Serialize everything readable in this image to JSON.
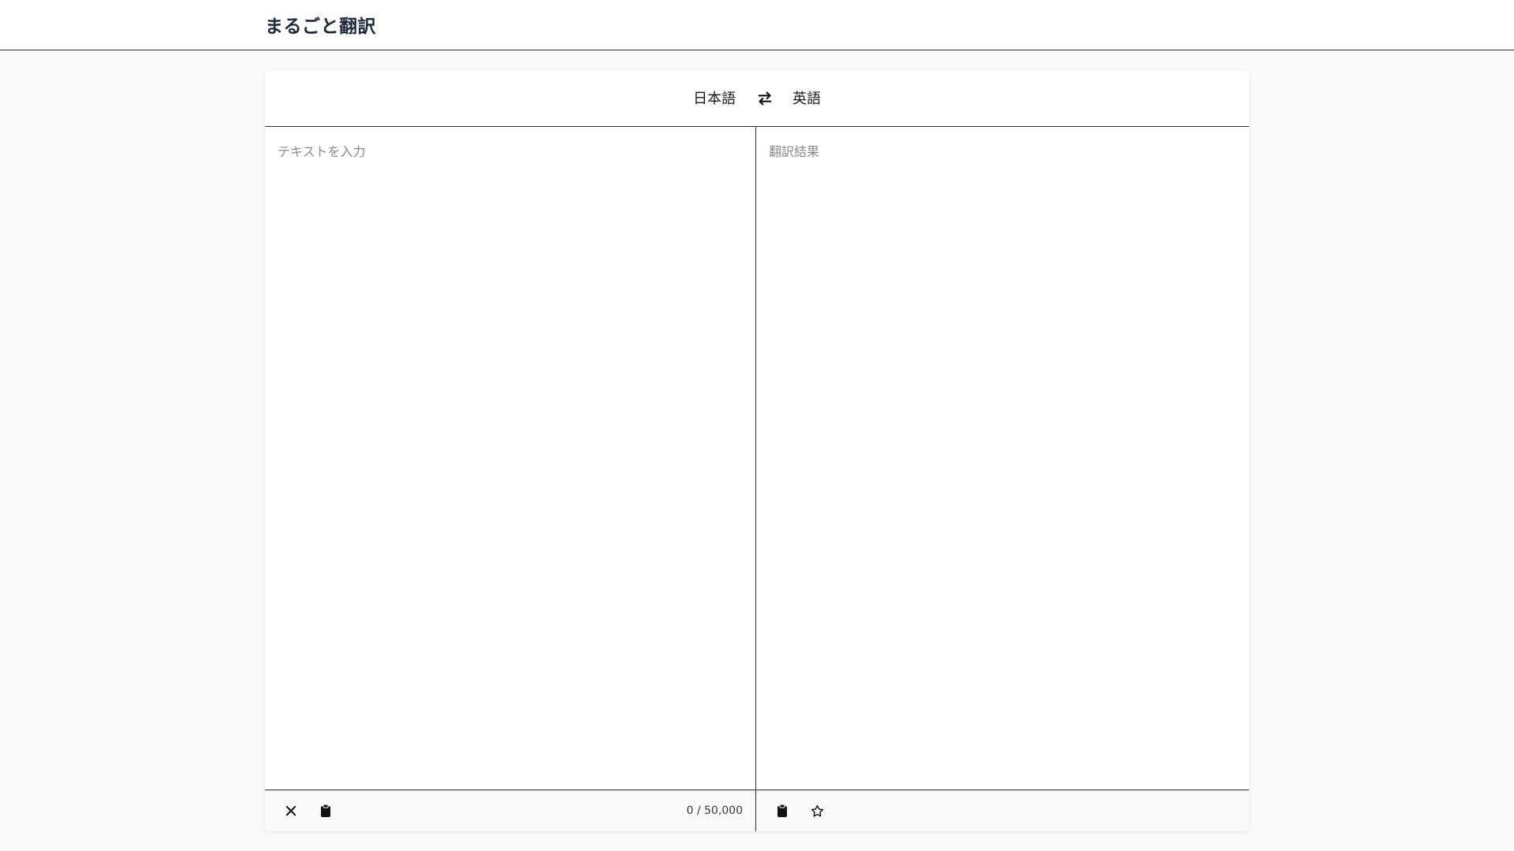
{
  "header": {
    "title": "まるごと翻訳"
  },
  "languages": {
    "source": "日本語",
    "target": "英語",
    "swap_icon": "swap-arrows-icon"
  },
  "source_pane": {
    "placeholder": "テキストを入力",
    "value": "",
    "char_count": "0 / 50,000",
    "actions": [
      {
        "name": "clear",
        "icon": "close-icon"
      },
      {
        "name": "paste",
        "icon": "clipboard-icon"
      }
    ]
  },
  "result_pane": {
    "placeholder": "翻訳結果",
    "actions": [
      {
        "name": "copy",
        "icon": "clipboard-icon"
      },
      {
        "name": "favorite",
        "icon": "star-icon"
      }
    ]
  }
}
